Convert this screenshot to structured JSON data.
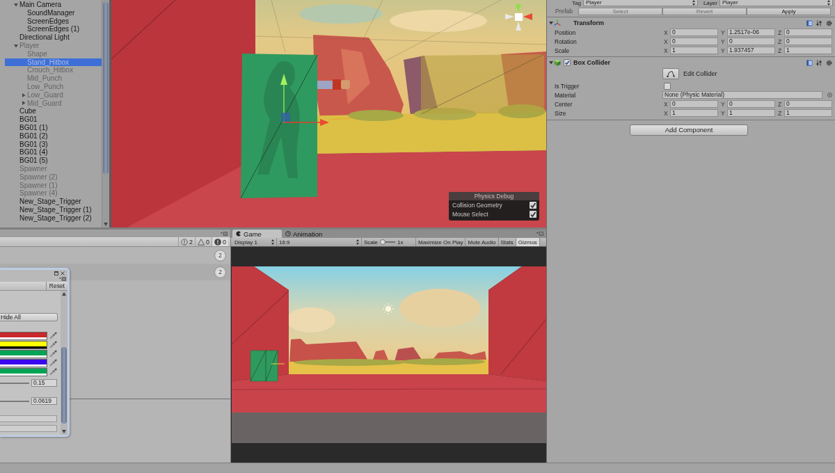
{
  "hierarchy": {
    "items": [
      {
        "name": "Main Camera",
        "active": true,
        "selected": false,
        "expanded": true,
        "children": [
          {
            "name": "SoundManager",
            "active": true,
            "selected": false
          },
          {
            "name": "ScreenEdges",
            "active": true,
            "selected": false
          },
          {
            "name": "ScreenEdges (1)",
            "active": true,
            "selected": false
          }
        ]
      },
      {
        "name": "Directional Light",
        "active": true,
        "selected": false
      },
      {
        "name": "Player",
        "active": false,
        "selected": false,
        "expanded": true,
        "children": [
          {
            "name": "Shape",
            "active": false,
            "selected": false
          },
          {
            "name": "Stand_Hitbox",
            "active": false,
            "selected": true
          },
          {
            "name": "Crouch_Hitbox",
            "active": false,
            "selected": false
          },
          {
            "name": "Mid_Punch",
            "active": false,
            "selected": false
          },
          {
            "name": "Low_Punch",
            "active": false,
            "selected": false
          },
          {
            "name": "Low_Guard",
            "active": false,
            "selected": false,
            "expanded": false
          },
          {
            "name": "Mid_Guard",
            "active": false,
            "selected": false,
            "expanded": false
          }
        ]
      },
      {
        "name": "Cube",
        "active": true,
        "selected": false
      },
      {
        "name": "BG01",
        "active": true,
        "selected": false
      },
      {
        "name": "BG01 (1)",
        "active": true,
        "selected": false
      },
      {
        "name": "BG01 (2)",
        "active": true,
        "selected": false
      },
      {
        "name": "BG01 (3)",
        "active": true,
        "selected": false
      },
      {
        "name": "BG01 (4)",
        "active": true,
        "selected": false
      },
      {
        "name": "BG01 (5)",
        "active": true,
        "selected": false
      },
      {
        "name": "Spawner",
        "active": false,
        "selected": false
      },
      {
        "name": "Spawner (2)",
        "active": false,
        "selected": false
      },
      {
        "name": "Spawner (1)",
        "active": false,
        "selected": false
      },
      {
        "name": "Spawner (4)",
        "active": false,
        "selected": false
      },
      {
        "name": "New_Stage_Trigger",
        "active": true,
        "selected": false
      },
      {
        "name": "New_Stage_Trigger (1)",
        "active": true,
        "selected": false
      },
      {
        "name": "New_Stage_Trigger (2)",
        "active": true,
        "selected": false
      }
    ]
  },
  "scene_view": {
    "physics_debug": {
      "title": "Physics Debug",
      "options": [
        {
          "label": "Collision Geometry",
          "checked": true
        },
        {
          "label": "Mouse Select",
          "checked": true
        }
      ]
    }
  },
  "inspector": {
    "tag": {
      "label": "Tag",
      "value": "Player"
    },
    "layer": {
      "label": "Layer",
      "value": "Player"
    },
    "prefab": {
      "label": "Prefab",
      "buttons": [
        {
          "label": "Select",
          "disabled": true
        },
        {
          "label": "Revert",
          "disabled": true
        },
        {
          "label": "Apply",
          "disabled": false
        }
      ]
    },
    "components": [
      {
        "kind": "transform",
        "title": "Transform",
        "expanded": true,
        "rows": [
          {
            "kind": "vector",
            "label": "Position",
            "values": [
              {
                "axis": "X",
                "value": "0"
              },
              {
                "axis": "Y",
                "value": "1.2517e-06"
              },
              {
                "axis": "Z",
                "value": "0"
              }
            ]
          },
          {
            "kind": "vector",
            "label": "Rotation",
            "values": [
              {
                "axis": "X",
                "value": "0"
              },
              {
                "axis": "Y",
                "value": "0"
              },
              {
                "axis": "Z",
                "value": "0"
              }
            ]
          },
          {
            "kind": "vector",
            "label": "Scale",
            "values": [
              {
                "axis": "X",
                "value": "1"
              },
              {
                "axis": "Y",
                "value": "1.937457"
              },
              {
                "axis": "Z",
                "value": "1"
              }
            ]
          }
        ]
      },
      {
        "kind": "collider",
        "title": "Box Collider",
        "expanded": true,
        "enabled": true,
        "rows": [
          {
            "kind": "edit_button",
            "label": "Edit Collider"
          },
          {
            "kind": "checkbox",
            "label": "Is Trigger",
            "checked": false
          },
          {
            "kind": "object",
            "label": "Material",
            "value": "None (Physic Material)"
          },
          {
            "kind": "vector",
            "label": "Center",
            "values": [
              {
                "axis": "X",
                "value": "0"
              },
              {
                "axis": "Y",
                "value": "0"
              },
              {
                "axis": "Z",
                "value": "0"
              }
            ]
          },
          {
            "kind": "vector",
            "label": "Size",
            "values": [
              {
                "axis": "X",
                "value": "1"
              },
              {
                "axis": "Y",
                "value": "1"
              },
              {
                "axis": "Z",
                "value": "1"
              }
            ]
          }
        ]
      }
    ],
    "add_component": "Add Component"
  },
  "console": {
    "counters": [
      {
        "kind": "info",
        "count": "2"
      },
      {
        "kind": "warning",
        "count": "0"
      },
      {
        "kind": "error",
        "count": "0"
      }
    ],
    "entries": [
      {
        "count": "2"
      },
      {
        "count": "2"
      }
    ]
  },
  "debug_window": {
    "reset": "Reset",
    "hide_all": "Hide All",
    "colors": [
      {
        "color": "#c9282c",
        "opaque": true
      },
      {
        "color": "#ffff00",
        "opaque": false
      },
      {
        "color": "#00a455",
        "opaque": true
      },
      {
        "color": "#3a06f0",
        "opaque": true
      },
      {
        "color": "#00a455",
        "opaque": true
      }
    ],
    "values": [
      "0.15",
      "0.0619"
    ]
  },
  "game_view": {
    "tabs": [
      {
        "label": "Game",
        "kind": "game",
        "selected": true
      },
      {
        "label": "Animation",
        "kind": "animation",
        "selected": false
      }
    ],
    "display": "Display 1",
    "aspect": "16:9",
    "scale": {
      "label": "Scale",
      "value": "1x",
      "level": 0
    },
    "toggles": [
      {
        "label": "Maximize On Play",
        "on": false
      },
      {
        "label": "Mute Audio",
        "on": false
      },
      {
        "label": "Stats",
        "on": false
      },
      {
        "label": "Gizmos",
        "on": true
      }
    ]
  }
}
